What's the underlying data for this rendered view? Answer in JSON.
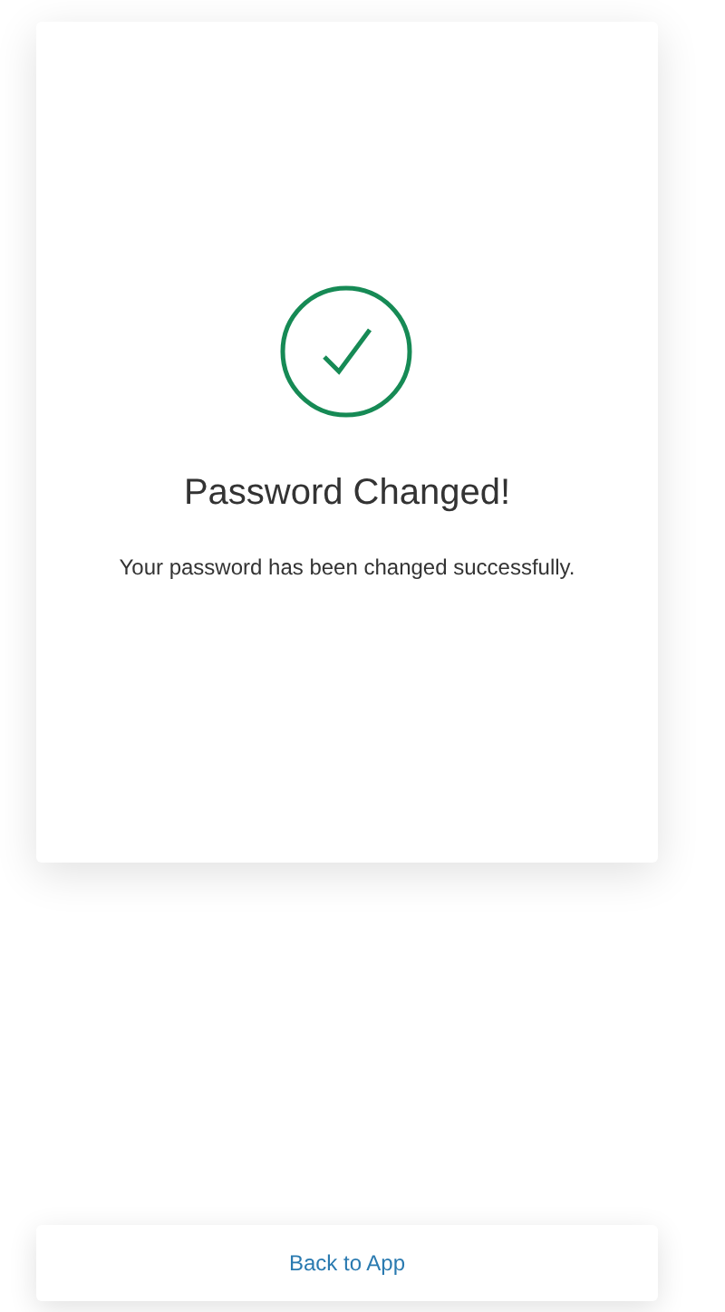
{
  "title": "Password Changed!",
  "message": "Your password has been changed successfully.",
  "link": "Back to App"
}
